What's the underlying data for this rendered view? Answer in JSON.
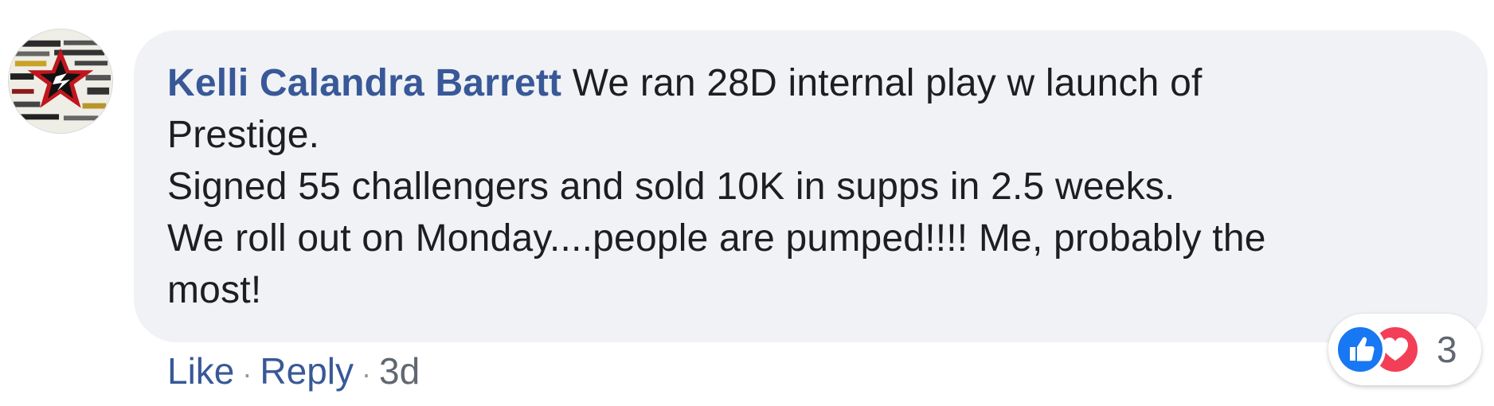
{
  "comment": {
    "author": "Kelli Calandra Barrett",
    "text_lines": [
      " We ran 28D internal play w launch of",
      "Prestige.",
      "Signed 55 challengers and sold 10K in supps in 2.5 weeks.",
      "We roll out on Monday....people are pumped!!!! Me, probably the",
      "most!"
    ]
  },
  "actions": {
    "like_label": "Like",
    "separator": "·",
    "reply_label": "Reply",
    "timestamp": "3d"
  },
  "reactions": {
    "icons": [
      "like-icon",
      "love-icon"
    ],
    "count": "3",
    "colors": {
      "like": "#1877f2",
      "love": "#f33e58"
    }
  },
  "colors": {
    "author": "#385898",
    "bubble": "#f0f2f5",
    "text": "#1c1e21",
    "meta": "#606770"
  }
}
